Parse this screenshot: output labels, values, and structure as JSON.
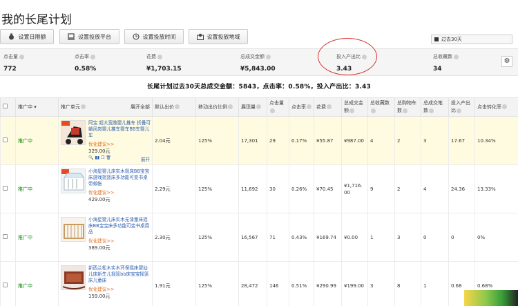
{
  "page": {
    "title": "我的长尾计划"
  },
  "toolbar": [
    {
      "label": "设置日限额",
      "icon": "money-bag-icon"
    },
    {
      "label": "设置投放平台",
      "icon": "computer-icon"
    },
    {
      "label": "设置投放时间",
      "icon": "clock-icon"
    },
    {
      "label": "设置投放地域",
      "icon": "region-icon"
    }
  ],
  "date_range": {
    "label": "过去30天"
  },
  "stats": [
    {
      "label": "点击量",
      "value": "772"
    },
    {
      "label": "点击率",
      "value": "0.58%"
    },
    {
      "label": "花费",
      "value": "¥1,703.15"
    },
    {
      "label": "总成交金额",
      "value": "¥5,843.00"
    },
    {
      "label": "投入产出比",
      "value": "3.43"
    },
    {
      "label": "总收藏数",
      "value": "34"
    }
  ],
  "summary": "长尾计划过去30天总成交金额：5843，点击率：0.58%，投入产出比：3.43",
  "table": {
    "headers": {
      "status": "推广中",
      "unit": "推广单元",
      "expand_all": "展开全部",
      "bid": "默认出价",
      "mobile": "移动出价比例",
      "impr": "展现量",
      "clicks": "点击量",
      "ctr": "点击率",
      "cost": "花费",
      "gmv": "总成交金额",
      "fav": "总收藏数",
      "cart": "总购物车数",
      "orders": "总成交笔数",
      "roi": "投入产出比",
      "cvr": "点击转化率"
    },
    "rows": [
      {
        "status": "推广中",
        "name": "阿宝 超大宽敞婴儿推车 折叠可躺风岗婴儿推车婴车BB车婴儿车",
        "opt": "优化建议>>",
        "price": "329.00元",
        "expand": "展开",
        "bid": "2.04元",
        "mobile": "125%",
        "impr": "17,301",
        "clicks": "29",
        "ctr": "0.17%",
        "cost": "¥55.87",
        "gmv": "¥987.00",
        "fav": "4",
        "cart": "2",
        "orders": "3",
        "roi": "17.67",
        "cvr": "10.34%"
      },
      {
        "status": "推广中",
        "name": "小海星婴儿床实木摇床BB宝宝床游戏摇篮床多功能可变书桌带蚊帐",
        "opt": "优化建议>>",
        "price": "429.00元",
        "bid": "2.29元",
        "mobile": "125%",
        "impr": "11,692",
        "clicks": "30",
        "ctr": "0.26%",
        "cost": "¥70.45",
        "gmv": "¥1,716.00",
        "fav": "9",
        "cart": "2",
        "orders": "4",
        "roi": "24.36",
        "cvr": "13.33%"
      },
      {
        "status": "推广中",
        "name": "小海星婴儿床实木无漆童床摇床BB宝宝床多功能可变书桌用品",
        "opt": "优化建议>>",
        "price": "389.00元",
        "bid": "2.30元",
        "mobile": "125%",
        "impr": "16,567",
        "clicks": "71",
        "ctr": "0.43%",
        "cost": "¥169.74",
        "gmv": "¥0.00",
        "fav": "1",
        "cart": "3",
        "orders": "0",
        "roi": "0",
        "cvr": "0%"
      },
      {
        "status": "推广中",
        "name": "新西兰松木实木环保摇床婴幼儿床新生儿摇篮bb床宝宝摇篮床儿童床",
        "opt": "优化建议>>",
        "price": "159.00元",
        "bid": "1.91元",
        "mobile": "125%",
        "impr": "28,472",
        "clicks": "146",
        "ctr": "0.51%",
        "cost": "¥290.99",
        "gmv": "¥199.00",
        "fav": "3",
        "cart": "8",
        "orders": "1",
        "roi": "0.68",
        "cvr": "0.68%"
      }
    ]
  }
}
